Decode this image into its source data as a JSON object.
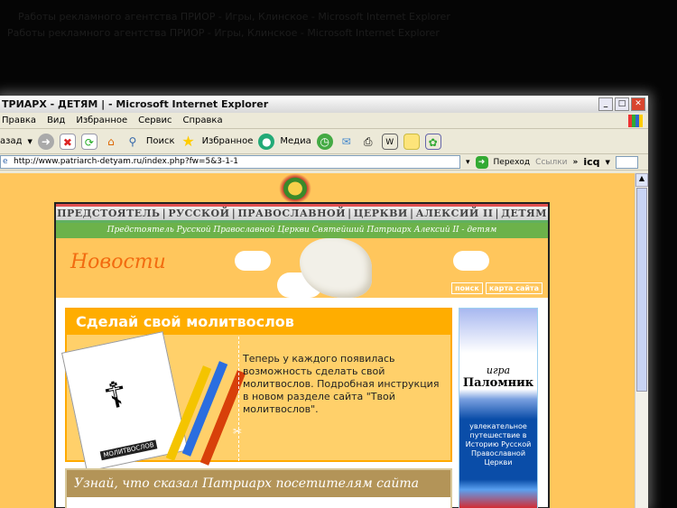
{
  "background_windows": [
    "Работы рекламного агентства ПРИОР - Игры, Клинское - Microsoft Internet Explorer",
    "Работы рекламного агентства ПРИОР - Игры, Клинское - Microsoft Internet Explorer"
  ],
  "window": {
    "title": "ТРИАРХ - ДЕТЯМ | - Microsoft Internet Explorer"
  },
  "menu": [
    "Правка",
    "Вид",
    "Избранное",
    "Сервис",
    "Справка"
  ],
  "toolbar": {
    "back": "азад",
    "search": "Поиск",
    "favorites": "Избранное",
    "media": "Медиа"
  },
  "address": {
    "url": "http://www.patriarch-detyam.ru/index.php?fw=5&3-1-1",
    "go": "Переход",
    "links": "Ссылки",
    "icq": "icq"
  },
  "site": {
    "nav": [
      "ПРЕДСТОЯТЕЛЬ",
      "РУССКОЙ",
      "ПРАВОСЛАВНОЙ",
      "ЦЕРКВИ",
      "АЛЕКСИЙ II",
      "ДЕТЯМ"
    ],
    "subtitle": "Предстоятель Русской Православной Церкви Святейший Патриарх Алексий II - детям",
    "section_title": "Новости",
    "search_link": "поиск",
    "sitemap_link": "карта сайта",
    "box1": {
      "title": "Сделай свой молитвослов",
      "text": "Теперь у каждого появилась возможность сделать свой молитвослов. Подробная инструкция в новом разделе сайта \"Твой молитвослов\".",
      "book_label": "МОЛИТВОСЛОВ"
    },
    "side_banner": {
      "igra": "игра",
      "name": "Паломник",
      "desc": "увлекательное путешествие в Историю Русской Православной Церкви"
    },
    "box2": {
      "title": "Узнай, что сказал Патриарх посетителям сайта"
    }
  }
}
